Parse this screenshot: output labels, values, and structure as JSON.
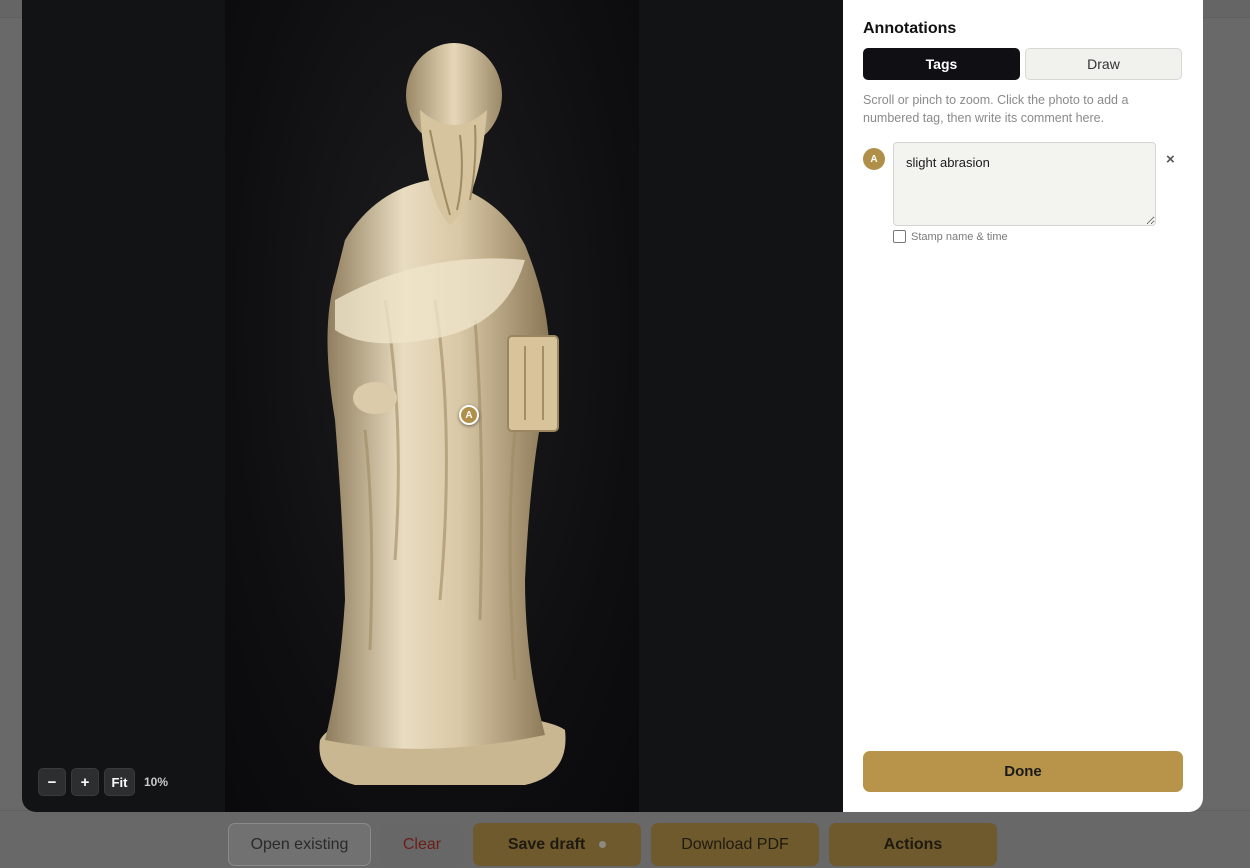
{
  "viewer": {
    "zoom_out_label": "−",
    "zoom_in_label": "+",
    "fit_label": "Fit",
    "zoom_level": "10%",
    "marker_label": "A"
  },
  "panel": {
    "title": "Annotations",
    "tabs": [
      {
        "label": "Tags",
        "active": true
      },
      {
        "label": "Draw",
        "active": false
      }
    ],
    "hint": "Scroll or pinch to zoom. Click the photo to add a numbered tag, then write its comment here.",
    "tags": [
      {
        "badge": "A",
        "comment": "slight abrasion",
        "stamp_label": "Stamp name & time",
        "stamp_checked": false,
        "remove_label": "×"
      }
    ],
    "done_label": "Done"
  },
  "bottom_bar": {
    "open_label": "Open existing",
    "clear_label": "Clear",
    "save_label": "Save draft",
    "pdf_label": "Download PDF",
    "actions_label": "Actions"
  },
  "colors": {
    "accent": "#b8944b",
    "tab_active": "#0f0f14",
    "viewer_bg": "#121314"
  }
}
